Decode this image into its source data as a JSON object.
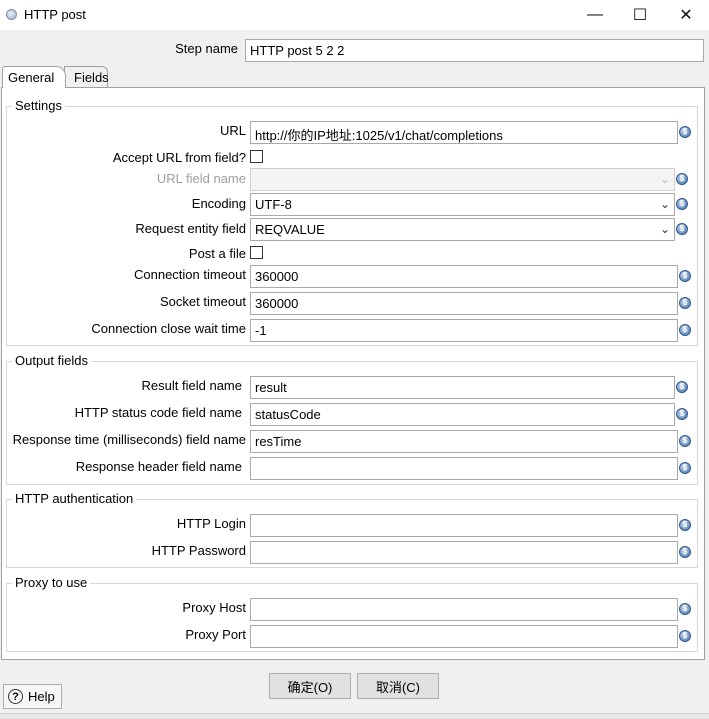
{
  "window": {
    "title": "HTTP post",
    "minimize": "—",
    "maximize": "☐",
    "close": "✕"
  },
  "step": {
    "label": "Step name",
    "value": "HTTP post 5 2 2"
  },
  "tabs": {
    "general": "General",
    "fields": "Fields"
  },
  "settings": {
    "title": "Settings",
    "url_label": "URL",
    "url_value": "http://你的IP地址:1025/v1/chat/completions",
    "accept_url_label": "Accept URL from field?",
    "url_field_name_label": "URL field name",
    "url_field_name_value": "",
    "encoding_label": "Encoding",
    "encoding_value": "UTF-8",
    "request_entity_label": "Request entity field",
    "request_entity_value": "REQVALUE",
    "post_file_label": "Post a file",
    "conn_timeout_label": "Connection timeout",
    "conn_timeout_value": "360000",
    "socket_timeout_label": "Socket timeout",
    "socket_timeout_value": "360000",
    "close_wait_label": "Connection close wait time",
    "close_wait_value": "-1"
  },
  "output": {
    "title": "Output fields",
    "result_label": "Result field name",
    "result_value": "result",
    "status_label": "HTTP status code field name",
    "status_value": "statusCode",
    "restime_label": "Response time (milliseconds) field name",
    "restime_value": "resTime",
    "header_label": "Response header field name",
    "header_value": ""
  },
  "auth": {
    "title": "HTTP authentication",
    "login_label": "HTTP Login",
    "login_value": "",
    "password_label": "HTTP Password",
    "password_value": ""
  },
  "proxy": {
    "title": "Proxy to use",
    "host_label": "Proxy Host",
    "host_value": "",
    "port_label": "Proxy Port",
    "port_value": ""
  },
  "buttons": {
    "ok": "确定(O)",
    "cancel": "取消(C)",
    "help": "Help"
  },
  "icons": {
    "variable": "variable-icon",
    "help": "question-icon",
    "dropdown": "chevron-down-icon"
  }
}
